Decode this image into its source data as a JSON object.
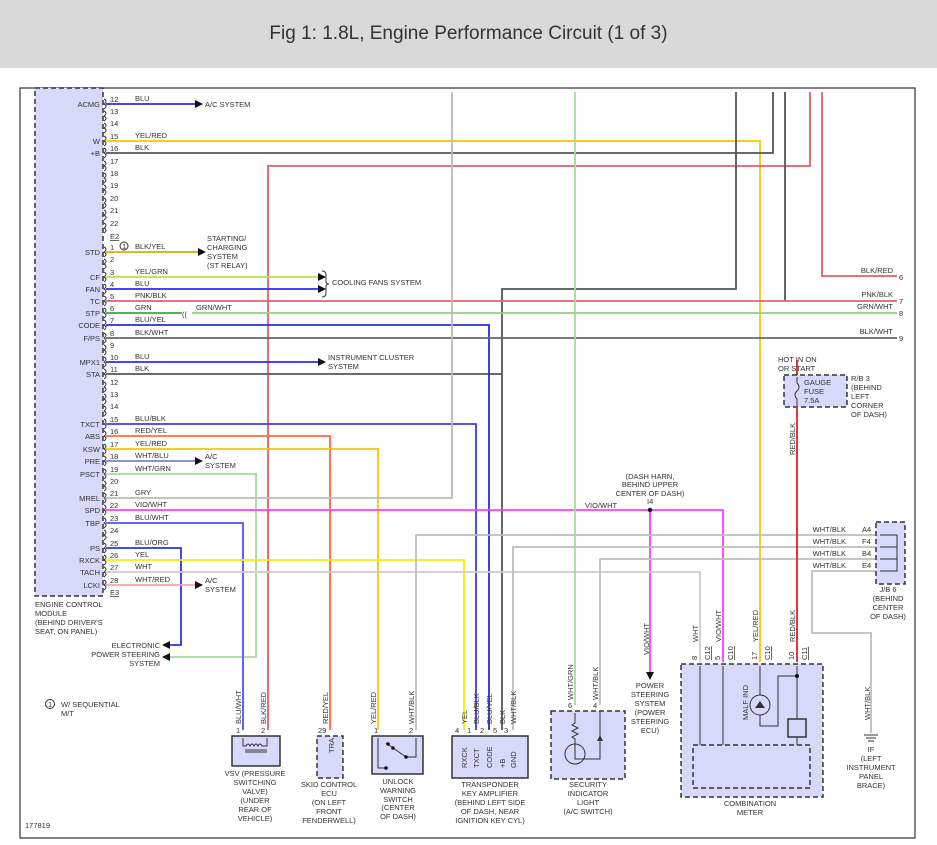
{
  "title": "Fig 1: 1.8L, Engine Performance Circuit (1 of 3)",
  "figure_number": "177819",
  "ecm": {
    "label": [
      "ENGINE CONTROL",
      "MODULE",
      "(BEHIND DRIVER'S",
      "SEAT, ON PANEL)"
    ],
    "connector_e2": "E2",
    "connector_e3": "E3",
    "pins_e2": [
      {
        "pin": "12",
        "terminal": "ACMG",
        "wire": "BLU"
      },
      {
        "pin": "13",
        "terminal": "",
        "wire": ""
      },
      {
        "pin": "14",
        "terminal": "",
        "wire": ""
      },
      {
        "pin": "15",
        "terminal": "W",
        "wire": "YEL/RED"
      },
      {
        "pin": "16",
        "terminal": "+B",
        "wire": "BLK"
      },
      {
        "pin": "17",
        "terminal": "",
        "wire": ""
      },
      {
        "pin": "18",
        "terminal": "",
        "wire": ""
      },
      {
        "pin": "19",
        "terminal": "",
        "wire": ""
      },
      {
        "pin": "20",
        "terminal": "",
        "wire": ""
      },
      {
        "pin": "21",
        "terminal": "",
        "wire": ""
      },
      {
        "pin": "22",
        "terminal": "",
        "wire": ""
      }
    ],
    "pins_e3": [
      {
        "pin": "1",
        "terminal": "STD",
        "wire": "BLK/YEL"
      },
      {
        "pin": "2",
        "terminal": "",
        "wire": ""
      },
      {
        "pin": "3",
        "terminal": "CF",
        "wire": "YEL/GRN"
      },
      {
        "pin": "4",
        "terminal": "FAN",
        "wire": "BLU"
      },
      {
        "pin": "5",
        "terminal": "TC",
        "wire": "PNK/BLK"
      },
      {
        "pin": "6",
        "terminal": "STP",
        "wire": "GRN"
      },
      {
        "pin": "7",
        "terminal": "CODE",
        "wire": "BLU/YEL"
      },
      {
        "pin": "8",
        "terminal": "F/PS",
        "wire": "BLK/WHT"
      },
      {
        "pin": "9",
        "terminal": "",
        "wire": ""
      },
      {
        "pin": "10",
        "terminal": "MPX1",
        "wire": "BLU"
      },
      {
        "pin": "11",
        "terminal": "STA",
        "wire": "BLK"
      },
      {
        "pin": "12",
        "terminal": "",
        "wire": ""
      },
      {
        "pin": "13",
        "terminal": "",
        "wire": ""
      },
      {
        "pin": "14",
        "terminal": "",
        "wire": ""
      },
      {
        "pin": "15",
        "terminal": "TXCT",
        "wire": "BLU/BLK"
      },
      {
        "pin": "16",
        "terminal": "ABS",
        "wire": "RED/YEL"
      },
      {
        "pin": "17",
        "terminal": "KSW",
        "wire": "YEL/RED"
      },
      {
        "pin": "18",
        "terminal": "PRE",
        "wire": "WHT/BLU"
      },
      {
        "pin": "19",
        "terminal": "PSCT",
        "wire": "WHT/GRN"
      },
      {
        "pin": "20",
        "terminal": "",
        "wire": ""
      },
      {
        "pin": "21",
        "terminal": "MREL",
        "wire": "GRY"
      },
      {
        "pin": "22",
        "terminal": "SPD",
        "wire": "VIO/WHT"
      },
      {
        "pin": "23",
        "terminal": "TBP",
        "wire": "BLU/WHT"
      },
      {
        "pin": "24",
        "terminal": "",
        "wire": ""
      },
      {
        "pin": "25",
        "terminal": "PS",
        "wire": "BLU/ORG"
      },
      {
        "pin": "26",
        "terminal": "RXCK",
        "wire": "YEL"
      },
      {
        "pin": "27",
        "terminal": "TACH",
        "wire": "WHT"
      },
      {
        "pin": "28",
        "terminal": "LCKI",
        "wire": "WHT/RED"
      }
    ]
  },
  "destinations": {
    "ac_system": "A/C SYSTEM",
    "starting": [
      "STARTING/",
      "CHARGING",
      "SYSTEM",
      "(ST RELAY)"
    ],
    "cooling_fans": "COOLING FANS SYSTEM",
    "instrument_cluster": [
      "INSTRUMENT CLUSTER",
      "SYSTEM"
    ],
    "ac_system_2": [
      "A/C",
      "SYSTEM"
    ],
    "ac_system_3": [
      "A/C",
      "SYSTEM"
    ],
    "eps": [
      "ELECTRONIC",
      "POWER STEERING",
      "SYSTEM"
    ],
    "continues": [
      {
        "num": "6",
        "wire": "BLK/RED"
      },
      {
        "num": "7",
        "wire": "PNK/BLK"
      },
      {
        "num": "8",
        "wire": "GRN/WHT"
      },
      {
        "num": "9",
        "wire": "BLK/WHT"
      }
    ],
    "stp_splice_wire": "GRN/WHT"
  },
  "note": {
    "marker": "1",
    "text": [
      "W/ SEQUENTIAL",
      "M/T"
    ]
  },
  "fuse": {
    "hot_label": [
      "HOT IN ON",
      "OR START"
    ],
    "name": [
      "GAUGE",
      "FUSE",
      "7.5A"
    ],
    "location": [
      "R/B 3",
      "(BEHIND",
      "LEFT",
      "CORNER",
      "OF DASH)"
    ],
    "wire": "RED/BLK"
  },
  "junction": {
    "name": "I4",
    "location": [
      "(DASH HARN,",
      "BEHIND UPPER",
      "CENTER OF DASH)"
    ],
    "wire_in": "VIO/WHT",
    "wire_down": "VIO/WHT"
  },
  "jb6": {
    "pins": [
      {
        "pin": "A4",
        "wire": "WHT/BLK"
      },
      {
        "pin": "F4",
        "wire": "WHT/BLK"
      },
      {
        "pin": "B4",
        "wire": "WHT/BLK"
      },
      {
        "pin": "E4",
        "wire": "WHT/BLK"
      }
    ],
    "label": [
      "J/B 6",
      "(BEHIND",
      "CENTER",
      "OF DASH)"
    ]
  },
  "ground": {
    "wire": "WHT/BLK",
    "label": [
      "IF",
      "(LEFT",
      "INSTRUMENT",
      "PANEL",
      "BRACE)"
    ]
  },
  "power_steering": {
    "label": [
      "POWER",
      "STEERING",
      "SYSTEM",
      "(POWER",
      "STEERING",
      "ECU)"
    ]
  },
  "components": {
    "vsv": {
      "pins": [
        {
          "pin": "1",
          "wire": "BLU/WHT"
        },
        {
          "pin": "2",
          "wire": "BLK/RED"
        }
      ],
      "label": [
        "VSV (PRESSURE",
        "SWITCHING",
        "VALVE)",
        "(UNDER",
        "REAR OF",
        "VEHICLE)"
      ]
    },
    "skid": {
      "pins": [
        {
          "pin": "29",
          "wire": "RED/YEL",
          "terminal": "TRA"
        }
      ],
      "label": [
        "SKID CONTROL",
        "ECU",
        "(ON LEFT",
        "FRONT",
        "FENDERWELL)"
      ]
    },
    "unlock": {
      "pins": [
        {
          "pin": "1",
          "wire": "YEL/RED"
        },
        {
          "pin": "2",
          "wire": "WHT/BLK"
        }
      ],
      "label": [
        "UNLOCK",
        "WARNING",
        "SWITCH",
        "(CENTER",
        "OF DASH)"
      ]
    },
    "transponder": {
      "pins": [
        {
          "pin": "4",
          "wire": "YEL",
          "terminal": "RXCK"
        },
        {
          "pin": "1",
          "wire": "BLU/BLK",
          "terminal": "TXCT"
        },
        {
          "pin": "2",
          "wire": "BLU/YEL",
          "terminal": "CODE"
        },
        {
          "pin": "5",
          "wire": "BLK",
          "terminal": "+B"
        },
        {
          "pin": "3",
          "wire": "WHT/BLK",
          "terminal": "GND"
        }
      ],
      "label": [
        "TRANSPONDER",
        "KEY AMPLIFIER",
        "(BEHIND LEFT SIDE",
        "OF DASH, NEAR",
        "IGNITION KEY CYL)"
      ]
    },
    "security": {
      "pins": [
        {
          "pin": "6",
          "wire": "WHT/GRN"
        },
        {
          "pin": "4",
          "wire": "WHT/BLK"
        }
      ],
      "label": [
        "SECURITY",
        "INDICATOR",
        "LIGHT",
        "(A/C SWITCH)"
      ]
    },
    "meter": {
      "pins": [
        {
          "pin": "8",
          "conn": "C12",
          "wire": "WHT"
        },
        {
          "pin": "5",
          "conn": "C10",
          "wire": "VIO/WHT"
        },
        {
          "pin": "17",
          "conn": "C10",
          "wire": "YEL/RED"
        },
        {
          "pin": "10",
          "conn": "C11",
          "wire": "RED/BLK"
        }
      ],
      "malf": "MALF IND",
      "label": [
        "COMBINATION",
        "METER"
      ]
    }
  },
  "wire_colors": {
    "BLU": "#2a2aff",
    "YEL/RED": "#f5c800",
    "BLK": "#555555",
    "BLK/RED": "#e06060",
    "BLK/YEL": "#c8b400",
    "YEL/GRN": "#b6e24a",
    "PNK/BLK": "#e0607a",
    "GRN": "#3aa83a",
    "GRN/WHT": "#8fd07f",
    "BLU/YEL": "#2a2ae0",
    "BLK/WHT": "#666666",
    "BLU/BLK": "#3b3bf0",
    "RED/YEL": "#ff6a40",
    "WHT/BLU": "#8080c8",
    "WHT/GRN": "#a8d8a0",
    "GRY": "#bbbbbb",
    "VIO/WHT": "#ff3cff",
    "BLU/WHT": "#5050ff",
    "BLU/ORG": "#3030e8",
    "YEL": "#f8ee00",
    "WHT": "#cccccc",
    "WHT/RED": "#f2a8a8",
    "WHT/BLK": "#bdbdbd",
    "RED/BLK": "#e02020",
    "ECM": "#d8d8fb"
  }
}
